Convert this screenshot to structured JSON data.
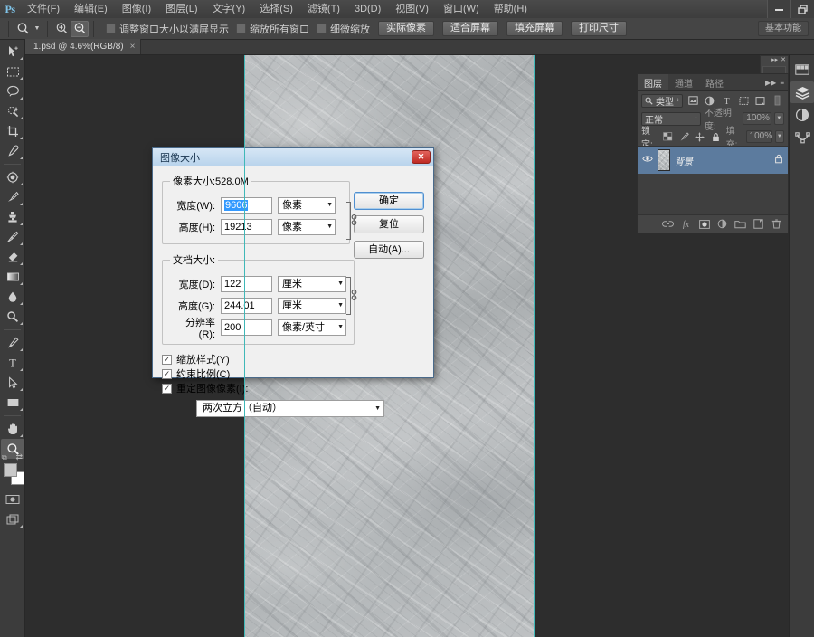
{
  "app": {
    "logo": "Ps"
  },
  "window_controls": [
    {
      "name": "minimize",
      "glyph": "—"
    },
    {
      "name": "restore",
      "glyph": "❐"
    }
  ],
  "menubar": [
    {
      "label": "文件(F)"
    },
    {
      "label": "编辑(E)"
    },
    {
      "label": "图像(I)"
    },
    {
      "label": "图层(L)"
    },
    {
      "label": "文字(Y)"
    },
    {
      "label": "选择(S)"
    },
    {
      "label": "滤镜(T)"
    },
    {
      "label": "3D(D)"
    },
    {
      "label": "视图(V)"
    },
    {
      "label": "窗口(W)"
    },
    {
      "label": "帮助(H)"
    }
  ],
  "options_bar": {
    "tool_icon": "zoom-tool-icon",
    "zoom_in_icon": "zoom-in-icon",
    "zoom_out_icon": "zoom-out-icon",
    "checkboxes": [
      {
        "label": "调整窗口大小以满屏显示",
        "checked": false
      },
      {
        "label": "缩放所有窗口",
        "checked": false
      },
      {
        "label": "细微缩放",
        "checked": false
      }
    ],
    "buttons": [
      {
        "label": "实际像素"
      },
      {
        "label": "适合屏幕"
      },
      {
        "label": "填充屏幕"
      },
      {
        "label": "打印尺寸"
      }
    ],
    "workspace": "基本功能"
  },
  "document_tab": {
    "label": "1.psd @ 4.6%(RGB/8)",
    "close_glyph": "×"
  },
  "toolbar": {
    "tools": [
      {
        "name": "move-tool",
        "glyph": "➤",
        "has_flyout": true,
        "active": false
      },
      {
        "name": "marquee-tool",
        "glyph": "⬚",
        "has_flyout": true,
        "active": false
      },
      {
        "name": "lasso-tool",
        "glyph": "⌀",
        "has_flyout": true,
        "active": false
      },
      {
        "name": "quick-selection-tool",
        "glyph": "✦",
        "has_flyout": true,
        "active": false
      },
      {
        "name": "crop-tool",
        "glyph": "⛏",
        "has_flyout": true,
        "active": false
      },
      {
        "name": "eyedropper-tool",
        "glyph": "✒",
        "has_flyout": true,
        "active": false
      },
      {
        "name": "spot-healing-tool",
        "glyph": "⬤",
        "has_flyout": true,
        "active": false
      },
      {
        "name": "brush-tool",
        "glyph": "✐",
        "has_flyout": true,
        "active": false
      },
      {
        "name": "clone-stamp-tool",
        "glyph": "♟",
        "has_flyout": true,
        "active": false
      },
      {
        "name": "history-brush-tool",
        "glyph": "✎",
        "has_flyout": true,
        "active": false
      },
      {
        "name": "eraser-tool",
        "glyph": "▰",
        "has_flyout": true,
        "active": false
      },
      {
        "name": "gradient-tool",
        "glyph": "▤",
        "has_flyout": true,
        "active": false
      },
      {
        "name": "blur-tool",
        "glyph": "●",
        "has_flyout": true,
        "active": false
      },
      {
        "name": "dodge-tool",
        "glyph": "⚲",
        "has_flyout": true,
        "active": false
      },
      {
        "name": "pen-tool",
        "glyph": "✑",
        "has_flyout": true,
        "active": false
      },
      {
        "name": "type-tool",
        "glyph": "T",
        "has_flyout": true,
        "active": false
      },
      {
        "name": "path-selection-tool",
        "glyph": "➤",
        "has_flyout": true,
        "active": false
      },
      {
        "name": "rectangle-tool",
        "glyph": "▭",
        "has_flyout": true,
        "active": false
      },
      {
        "name": "hand-tool",
        "glyph": "✋",
        "has_flyout": true,
        "active": false
      },
      {
        "name": "zoom-tool",
        "glyph": "⚲",
        "has_flyout": false,
        "active": true
      }
    ],
    "quickmask_glyph": "⧉",
    "screenmode_glyph": "❐"
  },
  "right_dock": {
    "icons": [
      {
        "name": "color-panel-icon",
        "glyph": "▒",
        "active": false
      },
      {
        "name": "layers-panel-icon",
        "glyph": "⬟",
        "active": true
      },
      {
        "name": "adjustments-panel-icon",
        "glyph": "◑",
        "active": false
      },
      {
        "name": "paths-panel-icon",
        "glyph": "✡",
        "active": false
      }
    ]
  },
  "layers_panel": {
    "tabs": [
      {
        "label": "图层",
        "active": true
      },
      {
        "label": "通道",
        "active": false
      },
      {
        "label": "路径",
        "active": false
      }
    ],
    "collapse_glyph": "▶▶",
    "menu_glyph": "≡",
    "filter": {
      "search_icon": "search-icon",
      "kind_label": "类型",
      "filter_icons": [
        {
          "name": "filter-pixel-icon",
          "glyph": "▣"
        },
        {
          "name": "filter-adjustment-icon",
          "glyph": "◑"
        },
        {
          "name": "filter-type-icon",
          "glyph": "T"
        },
        {
          "name": "filter-shape-icon",
          "glyph": "⬚"
        },
        {
          "name": "filter-smart-icon",
          "glyph": "◱"
        }
      ],
      "toggle_glyph": "▮"
    },
    "blend_mode": "正常",
    "opacity_label": "不透明度:",
    "opacity_value": "100%",
    "lock_label": "锁定:",
    "lock_icons": [
      {
        "name": "lock-transparent-pixels-icon",
        "glyph": "▨"
      },
      {
        "name": "lock-image-pixels-icon",
        "glyph": "✐"
      },
      {
        "name": "lock-position-icon",
        "glyph": "✥"
      },
      {
        "name": "lock-all-icon",
        "glyph": "🔒"
      }
    ],
    "fill_label": "填充:",
    "fill_value": "100%",
    "layers": [
      {
        "name": "背景",
        "visible": true,
        "locked": true,
        "selected": true,
        "eye_glyph": "◉",
        "lock_glyph": "🔒"
      }
    ],
    "footer_icons": [
      {
        "name": "link-layers-icon",
        "glyph": "⚭"
      },
      {
        "name": "layer-style-icon",
        "glyph": "ƒх"
      },
      {
        "name": "layer-mask-icon",
        "glyph": "▣"
      },
      {
        "name": "adjustment-layer-icon",
        "glyph": "◑"
      },
      {
        "name": "new-group-icon",
        "glyph": "🗀"
      },
      {
        "name": "new-layer-icon",
        "glyph": "❐"
      },
      {
        "name": "delete-layer-icon",
        "glyph": "🗑"
      }
    ]
  },
  "dialog": {
    "title": "图像大小",
    "close_glyph": "✕",
    "pixel_group": {
      "legend": "像素大小:528.0M",
      "rows": [
        {
          "label": "宽度(W):",
          "value": "9606",
          "unit": "像素",
          "selected": true
        },
        {
          "label": "高度(H):",
          "value": "19213",
          "unit": "像素",
          "selected": false
        }
      ],
      "chain_icon": "link-chain-icon"
    },
    "doc_group": {
      "legend": "文档大小:",
      "rows": [
        {
          "label": "宽度(D):",
          "value": "122",
          "unit": "厘米"
        },
        {
          "label": "高度(G):",
          "value": "244.01",
          "unit": "厘米"
        },
        {
          "label": "分辨率(R):",
          "value": "200",
          "unit": "像素/英寸"
        }
      ],
      "chain_icon": "link-chain-icon"
    },
    "checkboxes": [
      {
        "label": "缩放样式(Y)",
        "checked": true
      },
      {
        "label": "约束比例(C)",
        "checked": true
      },
      {
        "label": "重定图像像素(I):",
        "checked": true
      }
    ],
    "resample_method": "两次立方（自动）",
    "buttons": [
      {
        "label": "确定",
        "default": true
      },
      {
        "label": "复位",
        "default": false
      },
      {
        "label": "自动(A)...",
        "default": false
      }
    ],
    "check_glyph": "✓"
  },
  "colors": {
    "accent": "#3399ff",
    "dialog_title": "#b9d4ec",
    "layer_selected": "#5c7b9e",
    "guide": "#3fb8b8",
    "app_bg": "#333333",
    "canvas_bg": "#2d2d2d"
  }
}
